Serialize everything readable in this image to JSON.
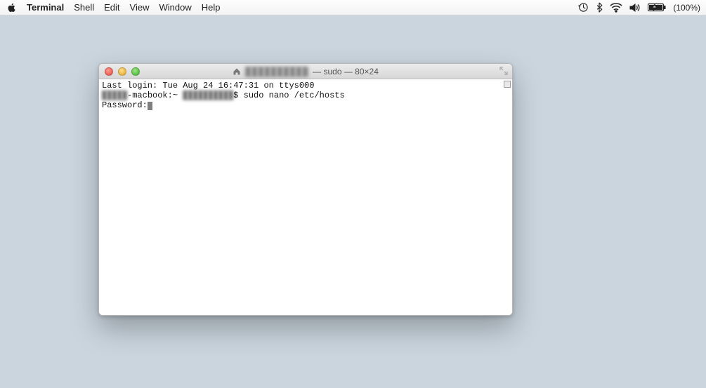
{
  "menubar": {
    "app_name": "Terminal",
    "items": [
      "Shell",
      "Edit",
      "View",
      "Window",
      "Help"
    ],
    "battery_text": "(100%)"
  },
  "window": {
    "title_blurred_user": "██████████",
    "title_suffix": " — sudo — 80×24"
  },
  "terminal": {
    "last_login": "Last login: Tue Aug 24 16:47:31 on ttys000",
    "host_prefix_blur": "█████",
    "host_suffix": "-macbook:~ ",
    "user_blur": "██████████",
    "prompt_char": "$ ",
    "command": "sudo nano /etc/hosts",
    "password_label": "Password:"
  }
}
